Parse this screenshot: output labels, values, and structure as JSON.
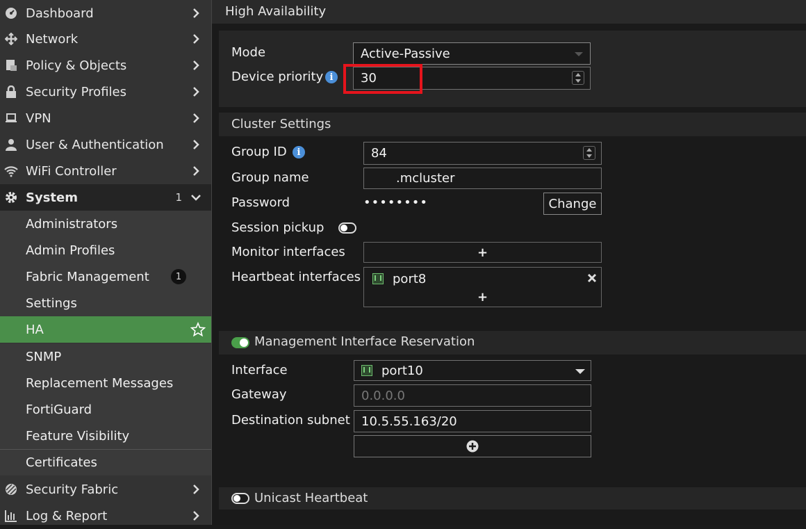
{
  "sidebar": {
    "top_items": [
      {
        "label": "Dashboard",
        "icon": "dashboard-icon"
      },
      {
        "label": "Network",
        "icon": "network-move-icon"
      },
      {
        "label": "Policy & Objects",
        "icon": "policy-icon"
      },
      {
        "label": "Security Profiles",
        "icon": "lock-icon"
      },
      {
        "label": "VPN",
        "icon": "laptop-icon"
      },
      {
        "label": "User & Authentication",
        "icon": "user-icon"
      },
      {
        "label": "WiFi Controller",
        "icon": "wifi-icon"
      }
    ],
    "system": {
      "label": "System",
      "count": "1",
      "icon": "gear-icon"
    },
    "system_children": [
      {
        "label": "Administrators"
      },
      {
        "label": "Admin Profiles"
      },
      {
        "label": "Fabric Management",
        "badge": "1"
      },
      {
        "label": "Settings"
      },
      {
        "label": "HA",
        "active": true
      },
      {
        "label": "SNMP"
      },
      {
        "label": "Replacement Messages"
      },
      {
        "label": "FortiGuard"
      },
      {
        "label": "Feature Visibility"
      },
      {
        "label": "Certificates"
      }
    ],
    "bottom_items": [
      {
        "label": "Security Fabric",
        "icon": "fabric-icon"
      },
      {
        "label": "Log & Report",
        "icon": "report-icon"
      }
    ]
  },
  "page": {
    "title": "High Availability"
  },
  "mode_section": {
    "mode_label": "Mode",
    "mode_value": "Active-Passive",
    "priority_label": "Device priority",
    "priority_value": "30"
  },
  "cluster": {
    "title": "Cluster Settings",
    "group_id_label": "Group ID",
    "group_id_value": "84",
    "group_name_label": "Group name",
    "group_name_value": ".mcluster",
    "password_label": "Password",
    "password_value": "••••••••",
    "change_label": "Change",
    "session_pickup_label": "Session pickup",
    "monitor_label": "Monitor interfaces",
    "heartbeat_label": "Heartbeat interfaces",
    "heartbeat_port": "port8",
    "add_symbol": "+"
  },
  "mgmt": {
    "title": "Management Interface Reservation",
    "interface_label": "Interface",
    "interface_value": "port10",
    "gateway_label": "Gateway",
    "gateway_placeholder": "0.0.0.0",
    "subnet_label": "Destination subnet",
    "subnet_value": "10.5.55.163/20"
  },
  "unicast": {
    "title": "Unicast Heartbeat"
  },
  "colors": {
    "active": "#4a8f4a",
    "highlight": "#e5141c",
    "info": "#4b8fd8"
  }
}
